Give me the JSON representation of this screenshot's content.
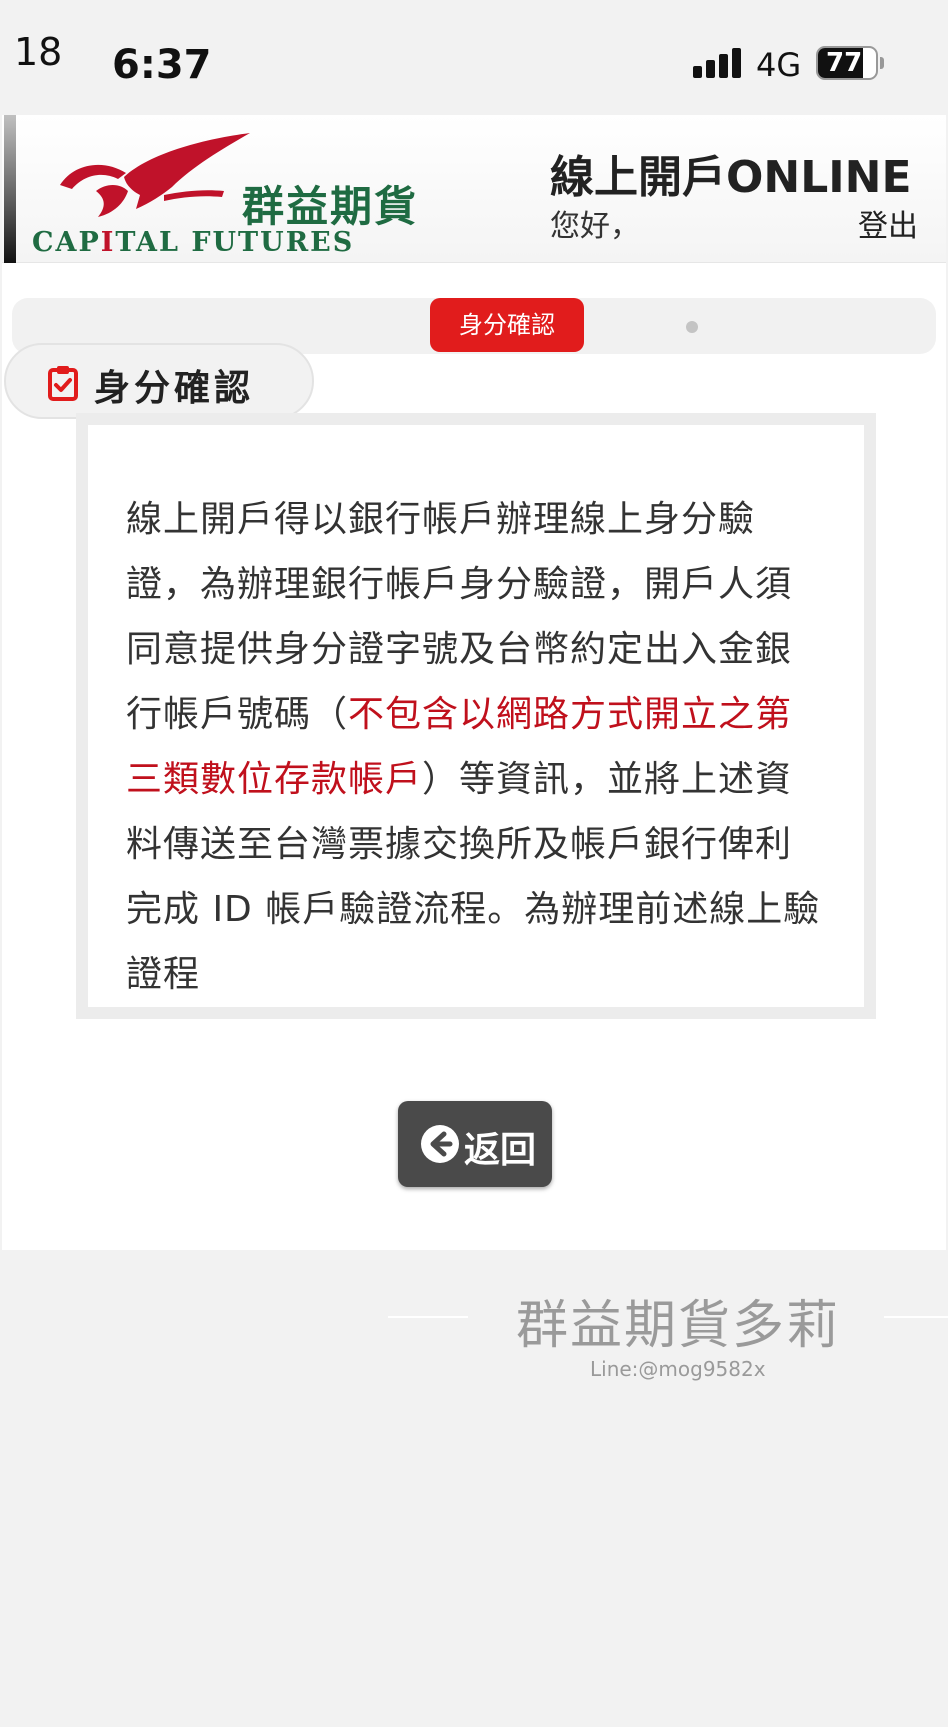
{
  "status_bar": {
    "corner_number": "18",
    "time": "6:37",
    "network": "4G",
    "battery_level": "77",
    "battery_fraction": 0.77
  },
  "header": {
    "logo_cn": "群益期貨",
    "logo_en_1": "CAP",
    "logo_en_2": "I",
    "logo_en_3": "TAL FUTURES",
    "title": "線上開戶ONLINE",
    "greeting": "您好，",
    "logout_label": "登出"
  },
  "steps": {
    "active_label": "身分確認"
  },
  "section": {
    "title": "身分確認"
  },
  "content": {
    "text_before": "線上開戶得以銀行帳戶辦理線上身分驗證，為辦理銀行帳戶身分驗證，開戶人須同意提供身分證字號及台幣約定出入金銀行帳戶號碼（",
    "text_red": "不包含以網路方式開立之第三類數位存款帳戶",
    "text_after": "）等資訊，並將上述資料傳送至台灣票據交換所及帳戶銀行俾利完成 ID 帳戶驗證流程。為辦理前述線上驗證程"
  },
  "back_button": {
    "label": "返回"
  },
  "watermark": {
    "title": "群益期貨多莉",
    "subtitle": "Line:@mog9582x"
  },
  "colors": {
    "brand_red": "#e11c1c",
    "brand_green": "#1f6b42",
    "emphasis_red": "#c0101c",
    "button_dark": "#4a4a4a"
  },
  "icons": {
    "section": "clipboard-check-icon",
    "back": "arrow-left-circle-icon",
    "logo": "eagle-logo-icon"
  }
}
